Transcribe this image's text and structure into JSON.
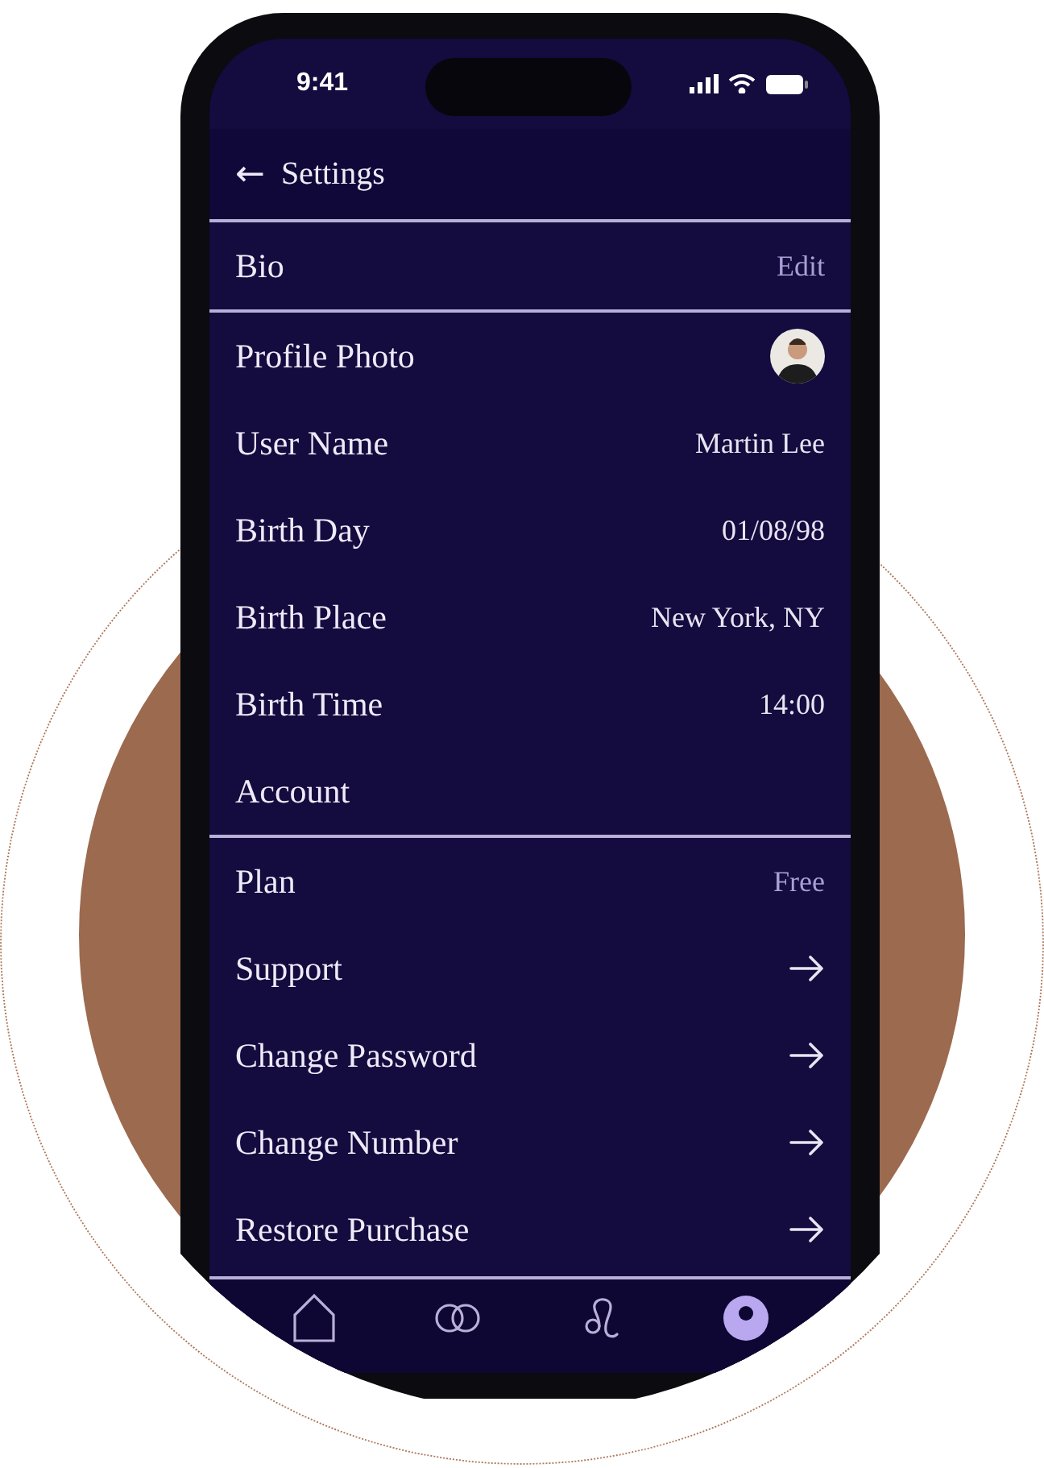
{
  "status_bar": {
    "time": "9:41"
  },
  "header": {
    "back": "←",
    "title": "Settings"
  },
  "sections": [
    {
      "rows": [
        {
          "kind": "text",
          "label": "Bio",
          "value": "Edit",
          "muted": true
        }
      ]
    },
    {
      "rows": [
        {
          "kind": "photo",
          "label": "Profile Photo"
        },
        {
          "kind": "text",
          "label": "User Name",
          "value": "Martin Lee",
          "muted": false
        },
        {
          "kind": "text",
          "label": "Birth Day",
          "value": "01/08/98",
          "muted": false
        },
        {
          "kind": "text",
          "label": "Birth Place",
          "value": "New York, NY",
          "muted": false
        },
        {
          "kind": "text",
          "label": "Birth Time",
          "value": "14:00",
          "muted": false
        },
        {
          "kind": "heading",
          "label": "Account"
        }
      ]
    },
    {
      "rows": [
        {
          "kind": "text",
          "label": "Plan",
          "value": "Free",
          "muted": true
        },
        {
          "kind": "arrow",
          "label": "Support"
        },
        {
          "kind": "arrow",
          "label": "Change Password"
        },
        {
          "kind": "arrow",
          "label": "Change Number"
        },
        {
          "kind": "arrow",
          "label": "Restore Purchase"
        }
      ]
    }
  ],
  "tab_bar": [
    {
      "kind": "home",
      "selected": false
    },
    {
      "kind": "rings",
      "selected": false
    },
    {
      "kind": "leo",
      "selected": false
    },
    {
      "kind": "profile",
      "selected": true
    }
  ]
}
